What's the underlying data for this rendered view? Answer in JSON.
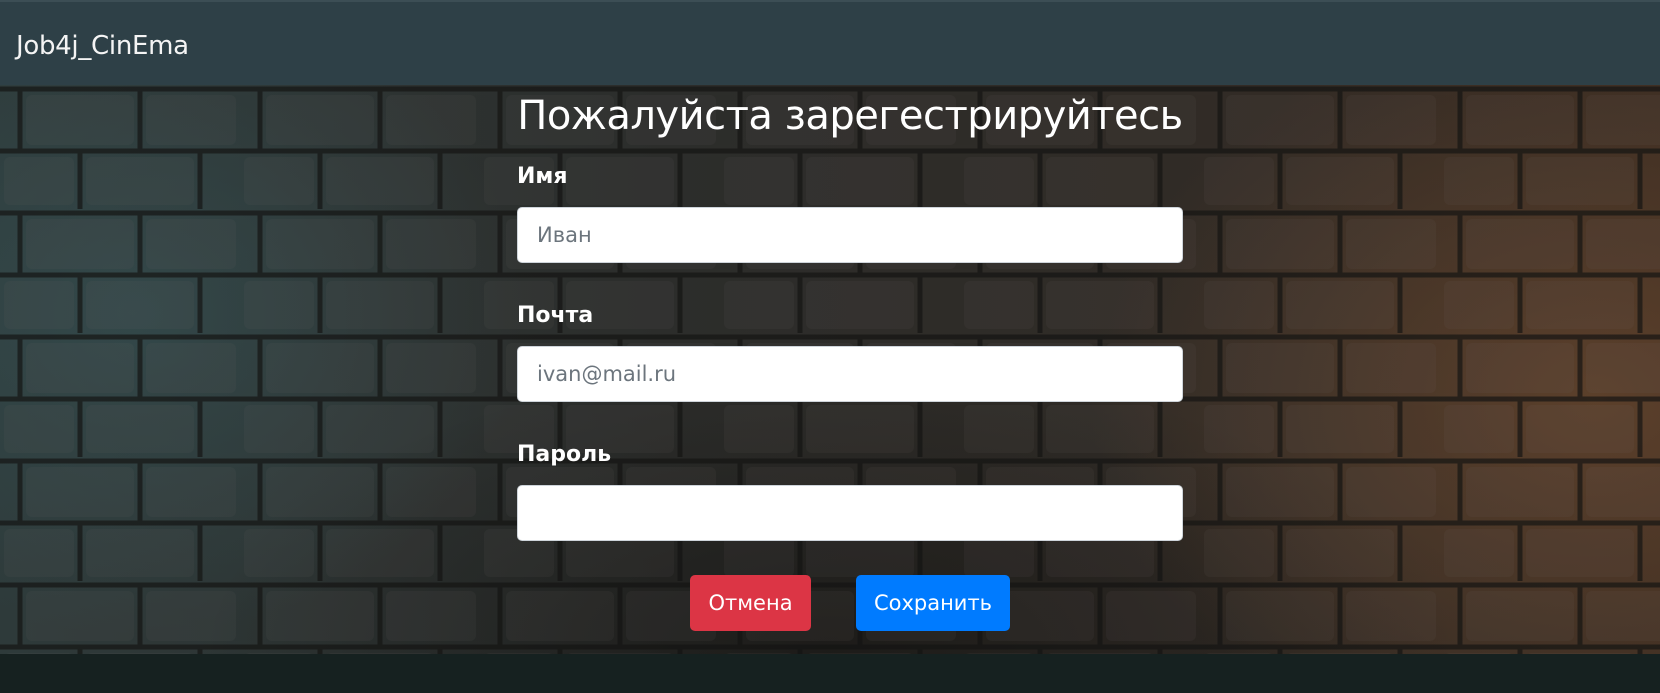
{
  "navbar": {
    "brand": "Job4j_CinEma"
  },
  "page": {
    "title": "Пожалуйста зарегестрируйтесь"
  },
  "form": {
    "name": {
      "label": "Имя",
      "value": "",
      "placeholder": "Иван"
    },
    "email": {
      "label": "Почта",
      "value": "",
      "placeholder": "ivan@mail.ru"
    },
    "password": {
      "label": "Пароль",
      "value": "",
      "placeholder": ""
    }
  },
  "buttons": {
    "cancel": "Отмена",
    "save": "Сохранить"
  },
  "colors": {
    "navbar": "#2e4047",
    "cancel": "#dc3545",
    "save": "#007bff",
    "footer": "#162120"
  }
}
